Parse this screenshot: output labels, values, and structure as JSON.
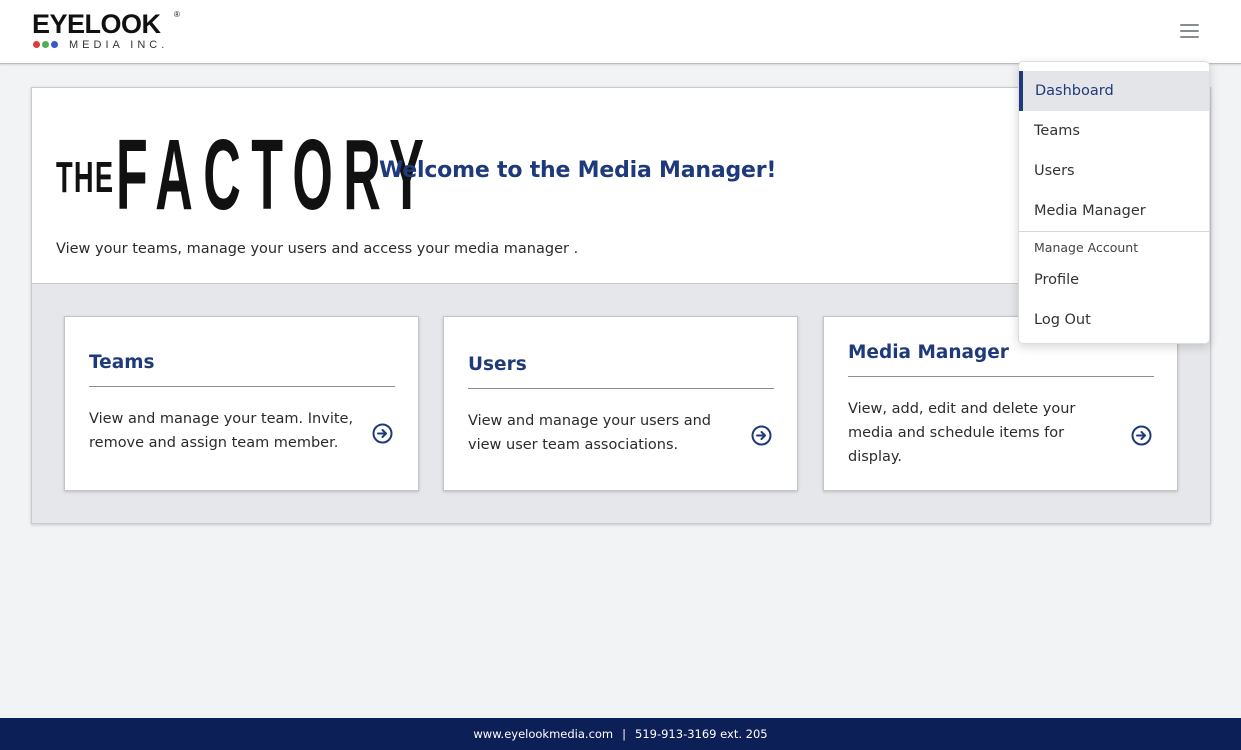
{
  "header": {
    "logo": {
      "name": "EYELOOK",
      "registered": "®",
      "subtitle": "MEDIA INC.",
      "dot_colors": [
        "#e23a3a",
        "#4caf50",
        "#3a56c7"
      ]
    },
    "menu_icon": "hamburger-menu-icon"
  },
  "welcome": {
    "logo_the": "THE",
    "logo_word": "FACTORY",
    "title": "Welcome to the Media Manager!",
    "description": "View your teams, manage your users and access your media manager ."
  },
  "tiles": [
    {
      "title": "Teams",
      "description": "View and manage your team. Invite, remove and assign team member.",
      "icon": "circle-arrow-right-icon"
    },
    {
      "title": "Users",
      "description": "View and manage your users and view user team associations.",
      "icon": "circle-arrow-right-icon"
    },
    {
      "title": "Media Manager",
      "description": "View, add, edit and delete your media and schedule items for display.",
      "icon": "circle-arrow-right-icon"
    }
  ],
  "dropdown": {
    "items": [
      {
        "label": "Dashboard",
        "active": true
      },
      {
        "label": "Teams",
        "active": false
      },
      {
        "label": "Users",
        "active": false
      },
      {
        "label": "Media Manager",
        "active": false
      }
    ],
    "section_label": "Manage Account",
    "account_items": [
      {
        "label": "Profile"
      },
      {
        "label": "Log Out"
      }
    ]
  },
  "footer": {
    "website": "www.eyelookmedia.com",
    "separator": "|",
    "phone": "519-913-3169 ext. 205"
  },
  "colors": {
    "brand_navy": "#1f3a7a",
    "footer_bg": "#0c1f57",
    "page_bg": "#f2f3f5",
    "active_menu_bg": "#e4e5e9"
  }
}
